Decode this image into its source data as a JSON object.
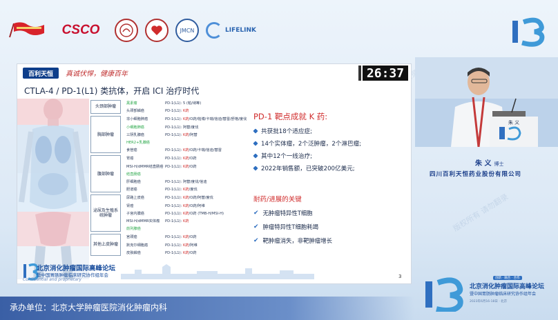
{
  "sponsor_logos": [
    {
      "name": "flag-logo"
    },
    {
      "name": "csco-logo",
      "text": "CSCO"
    },
    {
      "name": "society-seal-logo"
    },
    {
      "name": "heart-seal-logo"
    },
    {
      "name": "jmcn-seal-logo",
      "text": "JMCN"
    },
    {
      "name": "lifelink-logo",
      "text": "LIFELINK"
    }
  ],
  "slide": {
    "brand": "百利天恒",
    "slogan": "真诚伏悍，健康百年",
    "timer": "26:37",
    "title": "CTLA-4 / PD-1(L1) 类抗体，开启 ICI 治疗时代",
    "categories": [
      {
        "label": "头颈部肿瘤",
        "rows": [
          {
            "disease": "黑素瘤",
            "green": true,
            "agents": "PD-1(L1): ",
            "k": "",
            "rest": "5 (帕/纳等)"
          },
          {
            "disease": "头颈部鳞癌",
            "green": false,
            "agents": "PD-1(L1): ",
            "k": "K药",
            "rest": ""
          }
        ]
      },
      {
        "label": "胸部肿瘤",
        "rows": [
          {
            "disease": "非小细胞肺癌",
            "green": false,
            "agents": "PD-1(L1): ",
            "k": "K药",
            "rest": "/O药/帕博/卡瑞/信迪/替雷/舒格/度伐"
          },
          {
            "disease": "小细胞肺癌",
            "green": true,
            "agents": "PD-1(L1): ",
            "k": "",
            "rest": "阿替/度伐"
          },
          {
            "disease": "三阴乳腺癌",
            "green": false,
            "agents": "PD-1(L1): ",
            "k": "K药",
            "rest": "/阿替"
          },
          {
            "disease": "HER2+乳腺癌",
            "green": true,
            "agents": "",
            "k": "",
            "rest": ""
          },
          {
            "disease": "食管癌",
            "green": false,
            "agents": "PD-1(L1): ",
            "k": "K药",
            "rest": "/O药/卡瑞/信迪/替雷"
          }
        ]
      },
      {
        "label": "腹部肿瘤",
        "rows": [
          {
            "disease": "胃癌",
            "green": false,
            "agents": "PD-1(L1): ",
            "k": "K药",
            "rest": "/O药"
          },
          {
            "disease": "MSI-H/dMMR结直肠癌",
            "green": false,
            "agents": "PD-1(L1): ",
            "k": "K药",
            "rest": "/O药"
          },
          {
            "disease": "结直肠癌",
            "green": true,
            "agents": "",
            "k": "",
            "rest": ""
          },
          {
            "disease": "肝细胞癌",
            "green": false,
            "agents": "PD-1(L1): ",
            "k": "",
            "rest": "阿替/度伐/信迪"
          },
          {
            "disease": "胆道癌",
            "green": false,
            "agents": "PD-1(L1): ",
            "k": "K药",
            "rest": "/度伐"
          }
        ]
      },
      {
        "label": "泌尿及生殖系统肿瘤",
        "rows": [
          {
            "disease": "尿路上皮癌",
            "green": false,
            "agents": "PD-1(L1): ",
            "k": "K药",
            "rest": "/O药/阿替/度伐"
          },
          {
            "disease": "肾癌",
            "green": false,
            "agents": "PD-1(L1): ",
            "k": "K药",
            "rest": "/O药/阿维"
          },
          {
            "disease": "子宫内膜癌",
            "green": false,
            "agents": "PD-1(L1): ",
            "k": "K药",
            "rest": "/O药 (TMB-H/MSI-H)"
          },
          {
            "disease": "MSI-H/dMMR实体瘤",
            "green": false,
            "agents": "PD-1(L1): ",
            "k": "K药",
            "rest": ""
          },
          {
            "disease": "前列腺癌",
            "green": true,
            "agents": "",
            "k": "",
            "rest": ""
          }
        ]
      },
      {
        "label": "其他上皮肿瘤",
        "rows": [
          {
            "disease": "宫颈癌",
            "green": false,
            "agents": "PD-1(L1): ",
            "k": "K药",
            "rest": "/O药"
          },
          {
            "disease": "默克尔细胞癌",
            "green": false,
            "agents": "PD-1(L1): ",
            "k": "K药",
            "rest": "/阿维"
          },
          {
            "disease": "皮肤鳞癌",
            "green": false,
            "agents": "PD-1(L1): ",
            "k": "K药",
            "rest": "/O药"
          }
        ]
      }
    ],
    "pd1_title": "PD-1 靶点成就 K 药:",
    "bullets": [
      "共获批18个适应症;",
      "14个实体瘤，2个泛肿瘤，2个淋巴瘤;",
      "其中12个一线治疗;",
      "2022年销售额，已突破200亿美元;"
    ],
    "resistance_title": "耐药/进展的关键",
    "checks": [
      "无肿瘤特异性T细胞",
      "肿瘤特异性T细胞耗竭",
      "靶肿瘤消失，非靶肿瘤增长"
    ],
    "footer_title": "北京消化肿瘤国际高峰论坛",
    "footer_sub": "暨中国胃肠肿瘤临床研究协作组年会",
    "confidential": "Confidential and proprietary",
    "page_number": "3"
  },
  "speaker": {
    "name": "朱  义",
    "title": "博士",
    "organization": "四川百利天恒药业股份有限公司",
    "podium_name": "朱 义"
  },
  "conference": {
    "title": "北京消化肿瘤国际高峰论坛",
    "subtitle": "暨中国胃肠肿瘤临床研究协作组年会",
    "tag": "创新 · 融合 · 合作",
    "date": "2023年6月16-18日 · 北京"
  },
  "organizer": "承办单位：北京大学肿瘤医院消化肿瘤内科",
  "watermark_text": "版权所有 请勿翻录",
  "colors": {
    "accent_red": "#d02c2c",
    "brand_blue": "#1b4f9e",
    "highlight_green": "#2aa84a"
  }
}
